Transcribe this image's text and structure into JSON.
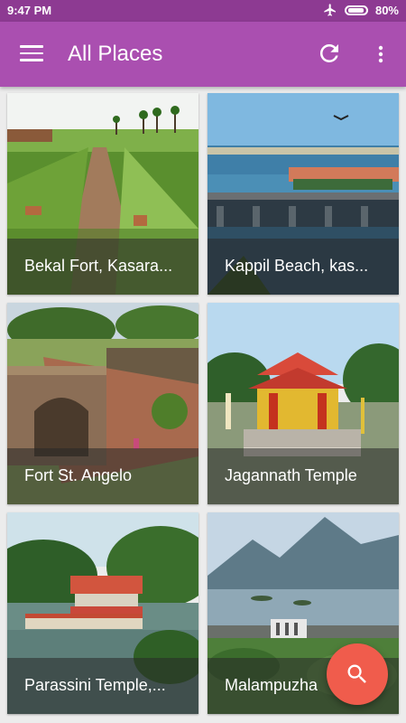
{
  "status_bar": {
    "time": "9:47 PM",
    "battery": "80%",
    "airplane_icon": "airplane-icon"
  },
  "app_bar": {
    "title": "All Places",
    "menu_icon": "menu-icon",
    "refresh_icon": "refresh-icon",
    "more_icon": "more-vert-icon"
  },
  "places": [
    {
      "name": "Bekal Fort, Kasara..."
    },
    {
      "name": "Kappil Beach, kas..."
    },
    {
      "name": "Fort St. Angelo"
    },
    {
      "name": "Jagannath Temple"
    },
    {
      "name": "Parassini Temple,..."
    },
    {
      "name": "Malampuzha"
    }
  ],
  "fab": {
    "icon": "search-icon"
  },
  "colors": {
    "status_bar": "#8d3a92",
    "app_bar": "#aa4fb0",
    "fab": "#f05c4c"
  }
}
